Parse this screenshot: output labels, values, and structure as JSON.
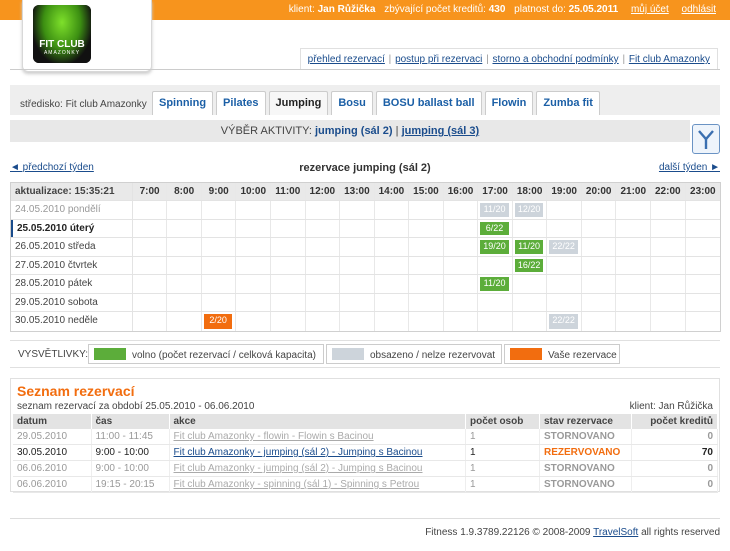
{
  "topbar": {
    "client_label": "klient:",
    "client_name": "Jan Růžička",
    "credits_label": "zbývající počet kreditů:",
    "credits": "430",
    "valid_label": "platnost do:",
    "valid_date": "25.05.2011",
    "account_link": "můj účet",
    "logout_link": "odhlásit"
  },
  "logo": {
    "line1": "FIT CLUB",
    "line2": "AMAZONKY"
  },
  "toplinks": [
    "přehled rezervací",
    "postup při rezervaci",
    "storno a obchodní podmínky",
    "Fit club Amazonky"
  ],
  "strediso": "středisko: Fit club Amazonky",
  "tabs": [
    "Spinning",
    "Pilates",
    "Jumping",
    "Bosu",
    "BOSU ballast ball",
    "Flowin",
    "Zumba fit"
  ],
  "activity": {
    "label": "VÝBĚR AKTIVITY:",
    "current": "jumping (sál 2)",
    "separator": "|",
    "other": "jumping (sál 3)"
  },
  "schedule": {
    "prev": "◄ předchozí týden",
    "next": "další týden ►",
    "title": "rezervace jumping (sál 2)",
    "updated": "aktualizace: 15:35:21",
    "hours": [
      "7:00",
      "8:00",
      "9:00",
      "10:00",
      "11:00",
      "12:00",
      "13:00",
      "14:00",
      "15:00",
      "16:00",
      "17:00",
      "18:00",
      "19:00",
      "20:00",
      "21:00",
      "22:00",
      "23:00"
    ],
    "days": [
      {
        "label": "24.05.2010 pondělí",
        "state": "past",
        "slots": {
          "10": {
            "t": "11/20",
            "s": "busy"
          },
          "11": {
            "t": "12/20",
            "s": "busy"
          }
        }
      },
      {
        "label": "25.05.2010 úterý",
        "state": "today",
        "slots": {
          "10": {
            "t": "6/22",
            "s": "free"
          }
        }
      },
      {
        "label": "26.05.2010 středa",
        "state": "",
        "slots": {
          "10": {
            "t": "19/20",
            "s": "free"
          },
          "11": {
            "t": "11/20",
            "s": "free"
          },
          "12": {
            "t": "22/22",
            "s": "busy"
          }
        }
      },
      {
        "label": "27.05.2010 čtvrtek",
        "state": "",
        "slots": {
          "11": {
            "t": "16/22",
            "s": "free"
          }
        }
      },
      {
        "label": "28.05.2010 pátek",
        "state": "",
        "slots": {
          "10": {
            "t": "11/20",
            "s": "free"
          }
        }
      },
      {
        "label": "29.05.2010 sobota",
        "state": "",
        "slots": {}
      },
      {
        "label": "30.05.2010 neděle",
        "state": "",
        "slots": {
          "2": {
            "t": "2/20",
            "s": "mine"
          },
          "12": {
            "t": "22/22",
            "s": "busy"
          }
        }
      }
    ]
  },
  "legend": {
    "title": "VYSVĚTLIVKY:",
    "free": "volno (počet rezervací / celková kapacita)",
    "busy": "obsazeno / nelze rezervovat",
    "mine": "Vaše rezervace",
    "colors": {
      "free": "#5cad3a",
      "busy": "#cdd4db",
      "mine": "#f26d0f"
    }
  },
  "reservations": {
    "title": "Seznam rezervací",
    "subtitle": "seznam rezervací za období 25.05.2010 - 06.06.2010",
    "client": "klient: Jan Růžička",
    "headers": [
      "datum",
      "čas",
      "akce",
      "počet osob",
      "stav rezervace",
      "počet kreditů"
    ],
    "rows": [
      {
        "date": "29.05.2010",
        "time": "11:00 - 11:45",
        "action": "Fit club Amazonky - flowin - Flowin s Bacinou",
        "persons": "1",
        "status": "STORNOVANO",
        "credits": "0",
        "active": false
      },
      {
        "date": "30.05.2010",
        "time": "9:00 - 10:00",
        "action": "Fit club Amazonky - jumping (sál 2) - Jumping s Bacinou",
        "persons": "1",
        "status": "REZERVOVANO",
        "credits": "70",
        "active": true
      },
      {
        "date": "06.06.2010",
        "time": "9:00 - 10:00",
        "action": "Fit club Amazonky - jumping (sál 2) - Jumping s Bacinou",
        "persons": "1",
        "status": "STORNOVANO",
        "credits": "0",
        "active": false
      },
      {
        "date": "06.06.2010",
        "time": "19:15 - 20:15",
        "action": "Fit club Amazonky - spinning (sál 1) - Spinning s Petrou",
        "persons": "1",
        "status": "STORNOVANO",
        "credits": "0",
        "active": false
      }
    ]
  },
  "footer": {
    "version": "Fitness 1.9.3789.22126",
    "copyright": "© 2008-2009",
    "company": "TravelSoft",
    "rights": "all rights reserved"
  }
}
